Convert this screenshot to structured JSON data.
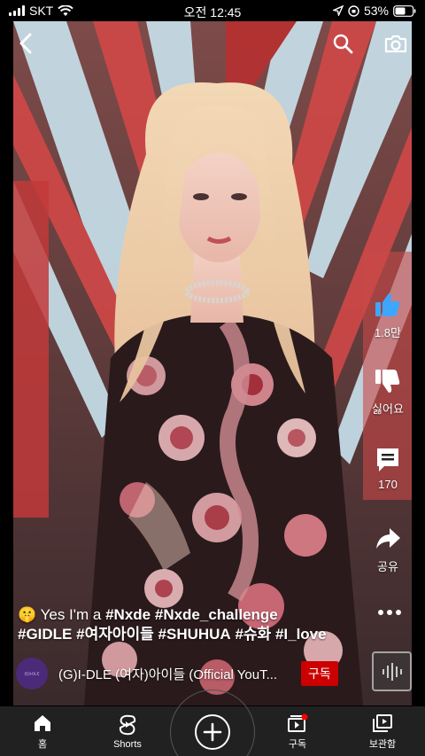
{
  "status_bar": {
    "carrier": "SKT",
    "time": "오전 12:45",
    "battery": "53%"
  },
  "header": {
    "back_icon": "chevron-left-icon",
    "search_icon": "search-icon",
    "camera_icon": "camera-icon"
  },
  "actions": {
    "like_count": "1.8만",
    "dislike_label": "싫어요",
    "comment_count": "170",
    "share_label": "공유"
  },
  "caption": {
    "emoji": "🤫",
    "prefix": "Yes I'm a ",
    "tag1": "#Nxde",
    "tag2": "#Nxde_challenge",
    "tag3": "#GIDLE",
    "tag4": "#여자아이들",
    "tag5": "#SHUHUA",
    "tag6": "#슈화",
    "tag7": "#I_love"
  },
  "channel": {
    "avatar_text": "(G)I-DLE",
    "name": "(G)I-DLE (여자)아이들 (Official YouT...",
    "subscribe_label": "구독"
  },
  "bottom_nav": {
    "home": "홈",
    "shorts": "Shorts",
    "subscriptions": "구독",
    "library": "보관함"
  },
  "colors": {
    "accent_red": "#cc0000",
    "like_blue": "#3ea6ff",
    "nav_bg": "#212121"
  }
}
